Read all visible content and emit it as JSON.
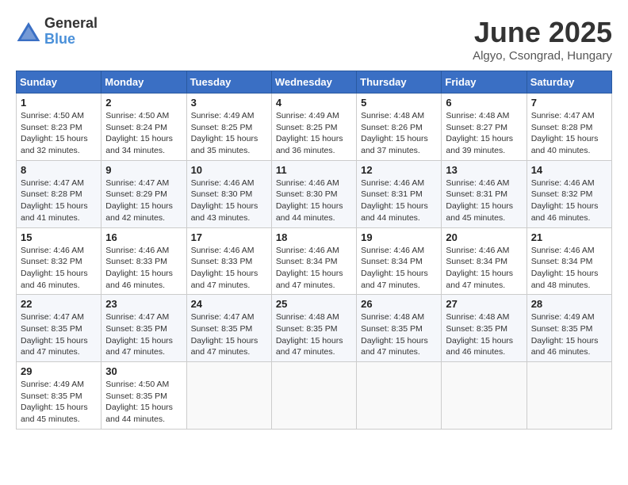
{
  "header": {
    "logo_general": "General",
    "logo_blue": "Blue",
    "month_title": "June 2025",
    "location": "Algyo, Csongrad, Hungary"
  },
  "days_of_week": [
    "Sunday",
    "Monday",
    "Tuesday",
    "Wednesday",
    "Thursday",
    "Friday",
    "Saturday"
  ],
  "weeks": [
    [
      {
        "day": "1",
        "sunrise": "4:50 AM",
        "sunset": "8:23 PM",
        "daylight": "15 hours and 32 minutes."
      },
      {
        "day": "2",
        "sunrise": "4:50 AM",
        "sunset": "8:24 PM",
        "daylight": "15 hours and 34 minutes."
      },
      {
        "day": "3",
        "sunrise": "4:49 AM",
        "sunset": "8:25 PM",
        "daylight": "15 hours and 35 minutes."
      },
      {
        "day": "4",
        "sunrise": "4:49 AM",
        "sunset": "8:25 PM",
        "daylight": "15 hours and 36 minutes."
      },
      {
        "day": "5",
        "sunrise": "4:48 AM",
        "sunset": "8:26 PM",
        "daylight": "15 hours and 37 minutes."
      },
      {
        "day": "6",
        "sunrise": "4:48 AM",
        "sunset": "8:27 PM",
        "daylight": "15 hours and 39 minutes."
      },
      {
        "day": "7",
        "sunrise": "4:47 AM",
        "sunset": "8:28 PM",
        "daylight": "15 hours and 40 minutes."
      }
    ],
    [
      {
        "day": "8",
        "sunrise": "4:47 AM",
        "sunset": "8:28 PM",
        "daylight": "15 hours and 41 minutes."
      },
      {
        "day": "9",
        "sunrise": "4:47 AM",
        "sunset": "8:29 PM",
        "daylight": "15 hours and 42 minutes."
      },
      {
        "day": "10",
        "sunrise": "4:46 AM",
        "sunset": "8:30 PM",
        "daylight": "15 hours and 43 minutes."
      },
      {
        "day": "11",
        "sunrise": "4:46 AM",
        "sunset": "8:30 PM",
        "daylight": "15 hours and 44 minutes."
      },
      {
        "day": "12",
        "sunrise": "4:46 AM",
        "sunset": "8:31 PM",
        "daylight": "15 hours and 44 minutes."
      },
      {
        "day": "13",
        "sunrise": "4:46 AM",
        "sunset": "8:31 PM",
        "daylight": "15 hours and 45 minutes."
      },
      {
        "day": "14",
        "sunrise": "4:46 AM",
        "sunset": "8:32 PM",
        "daylight": "15 hours and 46 minutes."
      }
    ],
    [
      {
        "day": "15",
        "sunrise": "4:46 AM",
        "sunset": "8:32 PM",
        "daylight": "15 hours and 46 minutes."
      },
      {
        "day": "16",
        "sunrise": "4:46 AM",
        "sunset": "8:33 PM",
        "daylight": "15 hours and 46 minutes."
      },
      {
        "day": "17",
        "sunrise": "4:46 AM",
        "sunset": "8:33 PM",
        "daylight": "15 hours and 47 minutes."
      },
      {
        "day": "18",
        "sunrise": "4:46 AM",
        "sunset": "8:34 PM",
        "daylight": "15 hours and 47 minutes."
      },
      {
        "day": "19",
        "sunrise": "4:46 AM",
        "sunset": "8:34 PM",
        "daylight": "15 hours and 47 minutes."
      },
      {
        "day": "20",
        "sunrise": "4:46 AM",
        "sunset": "8:34 PM",
        "daylight": "15 hours and 47 minutes."
      },
      {
        "day": "21",
        "sunrise": "4:46 AM",
        "sunset": "8:34 PM",
        "daylight": "15 hours and 48 minutes."
      }
    ],
    [
      {
        "day": "22",
        "sunrise": "4:47 AM",
        "sunset": "8:35 PM",
        "daylight": "15 hours and 47 minutes."
      },
      {
        "day": "23",
        "sunrise": "4:47 AM",
        "sunset": "8:35 PM",
        "daylight": "15 hours and 47 minutes."
      },
      {
        "day": "24",
        "sunrise": "4:47 AM",
        "sunset": "8:35 PM",
        "daylight": "15 hours and 47 minutes."
      },
      {
        "day": "25",
        "sunrise": "4:48 AM",
        "sunset": "8:35 PM",
        "daylight": "15 hours and 47 minutes."
      },
      {
        "day": "26",
        "sunrise": "4:48 AM",
        "sunset": "8:35 PM",
        "daylight": "15 hours and 47 minutes."
      },
      {
        "day": "27",
        "sunrise": "4:48 AM",
        "sunset": "8:35 PM",
        "daylight": "15 hours and 46 minutes."
      },
      {
        "day": "28",
        "sunrise": "4:49 AM",
        "sunset": "8:35 PM",
        "daylight": "15 hours and 46 minutes."
      }
    ],
    [
      {
        "day": "29",
        "sunrise": "4:49 AM",
        "sunset": "8:35 PM",
        "daylight": "15 hours and 45 minutes."
      },
      {
        "day": "30",
        "sunrise": "4:50 AM",
        "sunset": "8:35 PM",
        "daylight": "15 hours and 44 minutes."
      },
      null,
      null,
      null,
      null,
      null
    ]
  ]
}
